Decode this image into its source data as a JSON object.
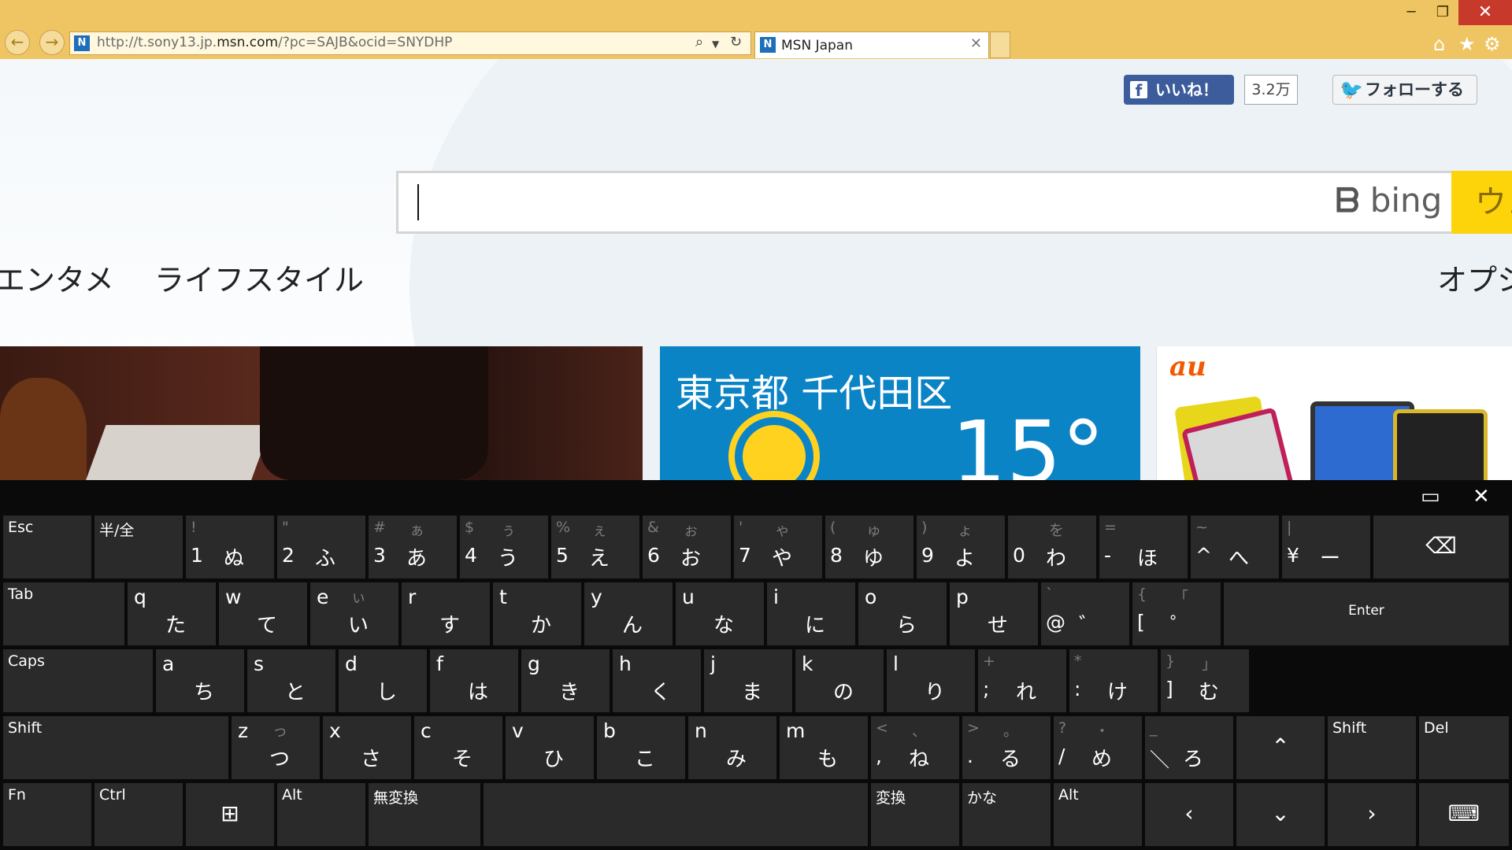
{
  "browser": {
    "url_host_prefix": "http://t.sony13.jp.",
    "url_host_bold": "msn.com",
    "url_rest": "/?pc=SAJB&ocid=SNYDHP",
    "tab_title": "MSN Japan",
    "favicon_letter": "N"
  },
  "page": {
    "fb_like_label": "いいね！",
    "fb_like_count": "3.2万",
    "twitter_follow_label": "フォローする",
    "search_placeholder": "",
    "search_engine": "bing",
    "search_button_label": "ウェ",
    "nav": [
      "エンタメ",
      "ライフスタイル",
      "オプシ"
    ],
    "weather": {
      "location": "東京都 千代田区",
      "temperature": "15°"
    },
    "ad_logo": "au"
  },
  "keyboard": {
    "rows": [
      [
        {
          "label": "Esc"
        },
        {
          "label": "半/全"
        },
        {
          "shift": "!",
          "kana_shift": "",
          "main": "1",
          "kana": "ぬ"
        },
        {
          "shift": "\"",
          "kana_shift": "",
          "main": "2",
          "kana": "ふ"
        },
        {
          "shift": "#",
          "kana_shift": "ぁ",
          "main": "3",
          "kana": "あ"
        },
        {
          "shift": "$",
          "kana_shift": "ぅ",
          "main": "4",
          "kana": "う"
        },
        {
          "shift": "%",
          "kana_shift": "ぇ",
          "main": "5",
          "kana": "え"
        },
        {
          "shift": "&",
          "kana_shift": "ぉ",
          "main": "6",
          "kana": "お"
        },
        {
          "shift": "'",
          "kana_shift": "ゃ",
          "main": "7",
          "kana": "や"
        },
        {
          "shift": "(",
          "kana_shift": "ゅ",
          "main": "8",
          "kana": "ゆ"
        },
        {
          "shift": ")",
          "kana_shift": "ょ",
          "main": "9",
          "kana": "よ"
        },
        {
          "shift": "",
          "kana_shift": "を",
          "main": "0",
          "kana": "わ"
        },
        {
          "shift": "=",
          "kana_shift": "",
          "main": "-",
          "kana": "ほ"
        },
        {
          "shift": "~",
          "kana_shift": "",
          "main": "^",
          "kana": "へ"
        },
        {
          "shift": "|",
          "kana_shift": "",
          "main": "¥",
          "kana": "ー"
        },
        {
          "icon": "backspace-icon",
          "glyph": "⌫"
        }
      ],
      [
        {
          "label": "Tab"
        },
        {
          "alpha": "q",
          "kana_shift": "",
          "kana": "た"
        },
        {
          "alpha": "w",
          "kana_shift": "",
          "kana": "て"
        },
        {
          "alpha": "e",
          "kana_shift": "ぃ",
          "kana": "い"
        },
        {
          "alpha": "r",
          "kana_shift": "",
          "kana": "す"
        },
        {
          "alpha": "t",
          "kana_shift": "",
          "kana": "か"
        },
        {
          "alpha": "y",
          "kana_shift": "",
          "kana": "ん"
        },
        {
          "alpha": "u",
          "kana_shift": "",
          "kana": "な"
        },
        {
          "alpha": "i",
          "kana_shift": "",
          "kana": "に"
        },
        {
          "alpha": "o",
          "kana_shift": "",
          "kana": "ら"
        },
        {
          "alpha": "p",
          "kana_shift": "",
          "kana": "せ"
        },
        {
          "shift": "`",
          "kana_shift": "",
          "main": "@",
          "kana": "゛"
        },
        {
          "shift": "{",
          "kana_shift": "「",
          "main": "[",
          "kana": "゜"
        },
        {
          "label": "Enter"
        }
      ],
      [
        {
          "label": "Caps"
        },
        {
          "alpha": "a",
          "kana_shift": "",
          "kana": "ち"
        },
        {
          "alpha": "s",
          "kana_shift": "",
          "kana": "と"
        },
        {
          "alpha": "d",
          "kana_shift": "",
          "kana": "し"
        },
        {
          "alpha": "f",
          "kana_shift": "",
          "kana": "は"
        },
        {
          "alpha": "g",
          "kana_shift": "",
          "kana": "き"
        },
        {
          "alpha": "h",
          "kana_shift": "",
          "kana": "く"
        },
        {
          "alpha": "j",
          "kana_shift": "",
          "kana": "ま"
        },
        {
          "alpha": "k",
          "kana_shift": "",
          "kana": "の"
        },
        {
          "alpha": "l",
          "kana_shift": "",
          "kana": "り"
        },
        {
          "shift": "+",
          "kana_shift": "",
          "main": ";",
          "kana": "れ"
        },
        {
          "shift": "*",
          "kana_shift": "",
          "main": ":",
          "kana": "け"
        },
        {
          "shift": "}",
          "kana_shift": "」",
          "main": "]",
          "kana": "む"
        }
      ],
      [
        {
          "label": "Shift"
        },
        {
          "alpha": "z",
          "kana_shift": "っ",
          "kana": "つ"
        },
        {
          "alpha": "x",
          "kana_shift": "",
          "kana": "さ"
        },
        {
          "alpha": "c",
          "kana_shift": "",
          "kana": "そ"
        },
        {
          "alpha": "v",
          "kana_shift": "",
          "kana": "ひ"
        },
        {
          "alpha": "b",
          "kana_shift": "",
          "kana": "こ"
        },
        {
          "alpha": "n",
          "kana_shift": "",
          "kana": "み"
        },
        {
          "alpha": "m",
          "kana_shift": "",
          "kana": "も"
        },
        {
          "shift": "<",
          "kana_shift": "、",
          "main": ",",
          "kana": "ね"
        },
        {
          "shift": ">",
          "kana_shift": "。",
          "main": ".",
          "kana": "る"
        },
        {
          "shift": "?",
          "kana_shift": "・",
          "main": "/",
          "kana": "め"
        },
        {
          "shift": "_",
          "kana_shift": "",
          "main": "＼",
          "kana": "ろ"
        },
        {
          "icon": "arrow-up-icon",
          "glyph": "⌃"
        },
        {
          "label": "Shift"
        },
        {
          "label": "Del"
        }
      ],
      [
        {
          "label": "Fn"
        },
        {
          "label": "Ctrl"
        },
        {
          "icon": "windows-icon",
          "glyph": "⊞"
        },
        {
          "label": "Alt"
        },
        {
          "label": "無変換"
        },
        {
          "label": ""
        },
        {
          "label": "変換"
        },
        {
          "label": "かな"
        },
        {
          "label": "Alt"
        },
        {
          "icon": "arrow-left-icon",
          "glyph": "‹"
        },
        {
          "icon": "arrow-down-icon",
          "glyph": "⌄"
        },
        {
          "icon": "arrow-right-icon",
          "glyph": "›"
        },
        {
          "icon": "keyboard-icon",
          "glyph": "⌨"
        }
      ]
    ]
  }
}
